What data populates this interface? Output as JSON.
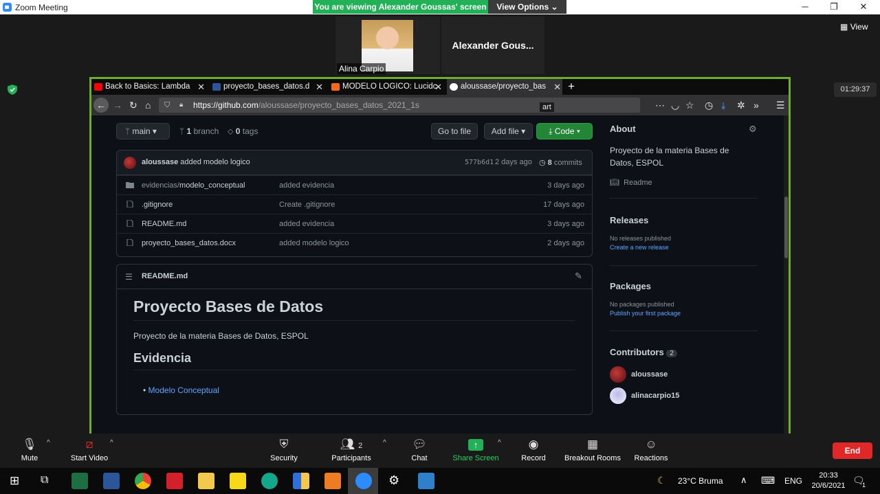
{
  "window": {
    "title": "Zoom Meeting",
    "controls": [
      "─",
      "❐",
      "✕"
    ]
  },
  "share_banner": {
    "text": "You are viewing Alexander Goussas' screen",
    "view_options": "View Options"
  },
  "participants": {
    "alina_name": "Alina Carpio",
    "alexander_name": "Alexander  Gous..."
  },
  "right_panel": {
    "view_label": "View",
    "timer": "01:29:37"
  },
  "browser": {
    "tabs": [
      {
        "label": "Back to Basics: Lambda",
        "favicon_color": "#ff0000"
      },
      {
        "label": "proyecto_bases_datos.d",
        "favicon_color": "#2b579a"
      },
      {
        "label": "MODELO LOGICO: Lucidc",
        "favicon_color": "#f26a1b"
      },
      {
        "label": "aloussase/proyecto_bas",
        "favicon_color": "#ffffff"
      }
    ],
    "new_tab": "+",
    "url_host": "https://github.com",
    "url_path": "/aloussase/proyecto_bases_datos_2021_1s",
    "tooltip": "art"
  },
  "repo": {
    "branch": "main",
    "branch_count": "1",
    "branch_label": "branch",
    "tag_count": "0",
    "tag_label": "tags",
    "go_to_file": "Go to file",
    "add_file": "Add file",
    "code": "Code",
    "commit": {
      "author": "aloussase",
      "message": "added modelo logico",
      "sha": "577b6d1",
      "age": "2 days ago",
      "count": "8",
      "count_label": "commits"
    },
    "files": [
      {
        "type": "folder",
        "dir": "evidencias/",
        "name": "modelo_conceptual",
        "message": "added evidencia",
        "age": "3 days ago"
      },
      {
        "type": "file",
        "dir": "",
        "name": ".gitignore",
        "message": "Create .gitignore",
        "age": "17 days ago"
      },
      {
        "type": "file",
        "dir": "",
        "name": "README.md",
        "message": "added evidencia",
        "age": "3 days ago"
      },
      {
        "type": "file",
        "dir": "",
        "name": "proyecto_bases_datos.docx",
        "message": "added modelo logico",
        "age": "2 days ago"
      }
    ],
    "readme": {
      "filename": "README.md",
      "h1": "Proyecto Bases de Datos",
      "paragraph": "Proyecto de la materia Bases de Datos, ESPOL",
      "h2": "Evidencia",
      "list_item": "Modelo Conceptual"
    },
    "sidebar": {
      "about_title": "About",
      "description_line1": "Proyecto de la materia Bases de",
      "description_line2": "Datos, ESPOL",
      "readme_link": "Readme",
      "releases_title": "Releases",
      "releases_none": "No releases published",
      "releases_create": "Create a new release",
      "packages_title": "Packages",
      "packages_none": "No packages published",
      "packages_publish": "Publish your first package",
      "contributors_title": "Contributors",
      "contributors_count": "2",
      "contributors": [
        "aloussase",
        "alinacarpio15"
      ]
    }
  },
  "toolbar": {
    "mute": "Mute",
    "start_video": "Start Video",
    "security": "Security",
    "participants": "Participants",
    "participants_count": "2",
    "chat": "Chat",
    "share_screen": "Share Screen",
    "record": "Record",
    "breakout_rooms": "Breakout Rooms",
    "reactions": "Reactions",
    "end": "End"
  },
  "taskbar": {
    "weather": "23°C  Bruma",
    "lang": "ENG",
    "time": "20:33",
    "date": "20/6/2021",
    "notifications": "1"
  }
}
